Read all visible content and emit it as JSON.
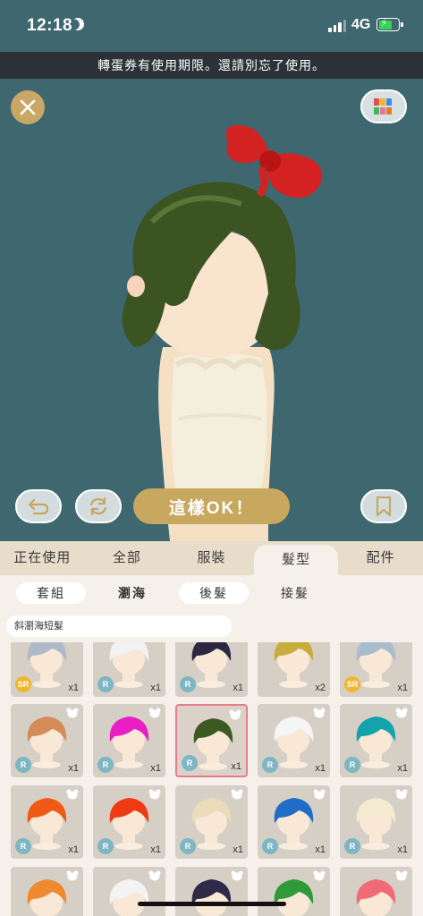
{
  "status_bar": {
    "time": "12:18",
    "network": "4G"
  },
  "notice": "轉蛋券有使用期限。還請別忘了使用。",
  "stage": {
    "ok_label": "這樣OK！"
  },
  "tabs": [
    {
      "label": "正在使用"
    },
    {
      "label": "全部"
    },
    {
      "label": "服裝"
    },
    {
      "label": "髮型"
    },
    {
      "label": "配件"
    }
  ],
  "subtabs": [
    {
      "label": "套組"
    },
    {
      "label": "瀏海"
    },
    {
      "label": "後髮"
    },
    {
      "label": "接髮"
    }
  ],
  "filter_label": "斜瀏海短髮",
  "items": [
    {
      "rarity": "SR",
      "count": "x1",
      "hair": "#aebac8"
    },
    {
      "rarity": "R",
      "count": "x1",
      "hair": "#f2f2f2"
    },
    {
      "rarity": "R",
      "count": "x1",
      "hair": "#2c2840"
    },
    {
      "rarity": "",
      "count": "x2",
      "hair": "#c9ad3c"
    },
    {
      "rarity": "SR",
      "count": "x1",
      "hair": "#a9bccb"
    },
    {
      "rarity": "R",
      "count": "x1",
      "hair": "#d48c58"
    },
    {
      "rarity": "R",
      "count": "x1",
      "hair": "#e81fc4"
    },
    {
      "rarity": "R",
      "count": "x1",
      "hair": "#3e5a24"
    },
    {
      "rarity": "R",
      "count": "x1",
      "hair": "#f5f5f5"
    },
    {
      "rarity": "R",
      "count": "x1",
      "hair": "#12a3ad"
    },
    {
      "rarity": "R",
      "count": "x1",
      "hair": "#f05a17"
    },
    {
      "rarity": "R",
      "count": "x1",
      "hair": "#f03b12"
    },
    {
      "rarity": "R",
      "count": "x1",
      "hair": "#eadcb8"
    },
    {
      "rarity": "R",
      "count": "x1",
      "hair": "#1f6cc9"
    },
    {
      "rarity": "R",
      "count": "x1",
      "hair": "#f3ecd0"
    },
    {
      "rarity": "",
      "count": "",
      "hair": "#f08a30"
    },
    {
      "rarity": "",
      "count": "",
      "hair": "#f3f3f3"
    },
    {
      "rarity": "",
      "count": "",
      "hair": "#2e2a48"
    },
    {
      "rarity": "",
      "count": "",
      "hair": "#2f9a3a"
    },
    {
      "rarity": "",
      "count": "",
      "hair": "#f06a78"
    }
  ],
  "colors": {
    "bg": "#3e6770",
    "gold": "#c8a75f",
    "rare_r": "#7fb6c4",
    "rare_sr": "#f0b630",
    "selected": "#e87b8c"
  },
  "icons": [
    "close-icon",
    "color-grid-icon",
    "undo-icon",
    "refresh-icon",
    "bookmark-icon",
    "bear-icon"
  ]
}
